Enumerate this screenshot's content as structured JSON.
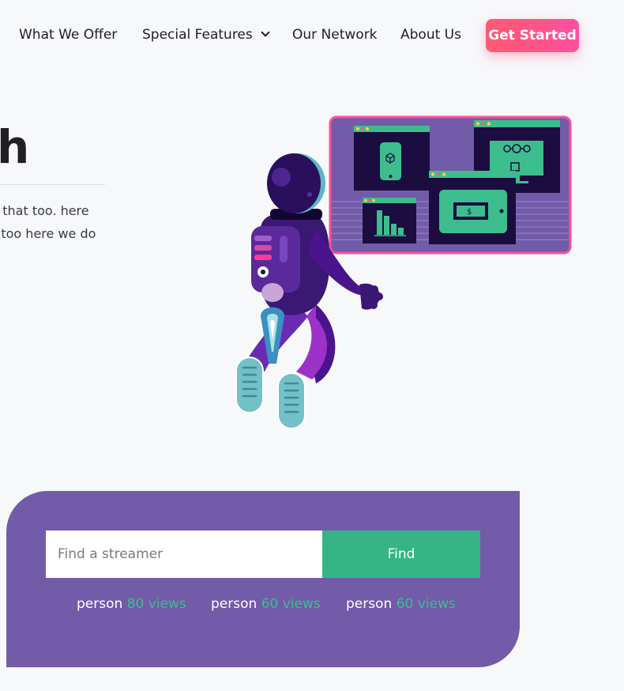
{
  "nav": {
    "items": [
      "What We Offer",
      "Special Features",
      "Our Network",
      "About Us"
    ],
    "cta": "Get Started"
  },
  "hero": {
    "heading_fragment": "h",
    "text_line1": "d that too. here",
    "text_line2": "t too here we do"
  },
  "search": {
    "placeholder": "Find a streamer",
    "button": "Find",
    "streamers": [
      {
        "name": "person",
        "views": "80 views"
      },
      {
        "name": "person",
        "views": "60 views"
      },
      {
        "name": "person",
        "views": "60 views"
      }
    ]
  },
  "colors": {
    "accent_green": "#35b585",
    "panel_purple": "#725ba8",
    "cta_pink": "#ff5a82"
  }
}
